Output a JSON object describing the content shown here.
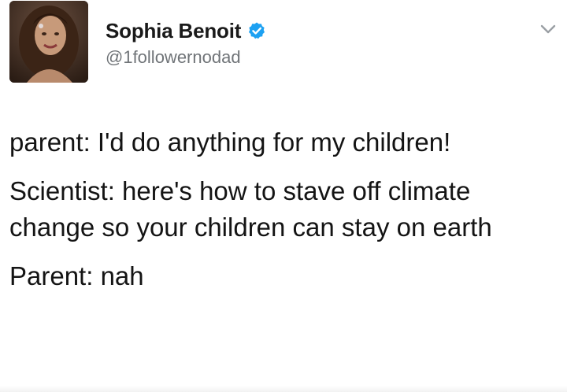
{
  "author": {
    "display_name": "Sophia Benoit",
    "handle": "@1followernodad",
    "verified_icon": "verified-badge-icon",
    "avatar_icon": "profile-photo",
    "verified_color": "#1DA1F2"
  },
  "menu": {
    "icon": "chevron-down-icon"
  },
  "tweet": {
    "lines": [
      "parent: I'd do anything for my children!",
      "Scientist: here's how to stave off climate change so your children can stay on earth",
      "Parent: nah"
    ]
  }
}
